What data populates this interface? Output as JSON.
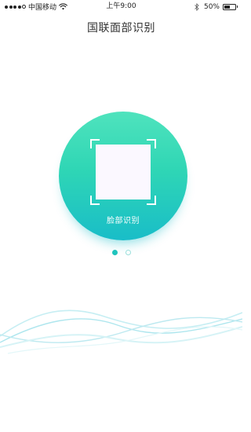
{
  "status_bar": {
    "carrier": "中国移动",
    "time": "上午9:00",
    "battery_percent": "50%",
    "battery_level": 0.5,
    "signal_bars_filled": 4,
    "signal_bars_total": 5,
    "icons": [
      "signal-icon",
      "wifi-icon",
      "bluetooth-icon",
      "battery-icon"
    ]
  },
  "header": {
    "title": "国联面部识别"
  },
  "main": {
    "recognize_button": {
      "label": "脸部识别",
      "icon": "face-scan-frame-icon"
    },
    "pager": {
      "total": 2,
      "active_index": 0
    }
  },
  "colors": {
    "accent": "#1fc4bd",
    "gradient_top": "#4fe3bd",
    "gradient_bottom": "#19bdc8",
    "wave": "#a9e6ee"
  }
}
